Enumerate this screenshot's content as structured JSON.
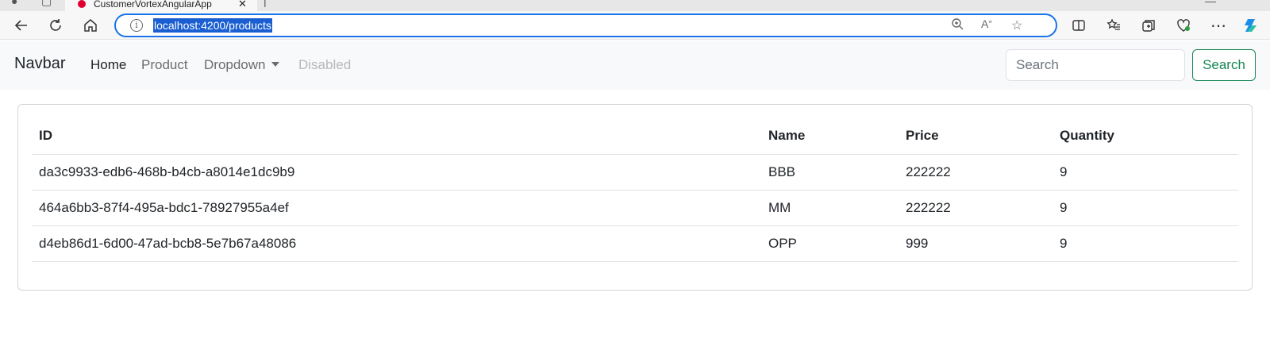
{
  "browser": {
    "tab_title": "CustomerVortexAngularApp",
    "url": "localhost:4200/products"
  },
  "navbar": {
    "brand": "Navbar",
    "links": [
      {
        "label": "Home"
      },
      {
        "label": "Product"
      },
      {
        "label": "Dropdown"
      },
      {
        "label": "Disabled"
      }
    ],
    "search_placeholder": "Search",
    "search_button": "Search"
  },
  "table": {
    "headers": [
      "ID",
      "Name",
      "Price",
      "Quantity"
    ],
    "rows": [
      [
        "da3c9933-edb6-468b-b4cb-a8014e1dc9b9",
        "BBB",
        "222222",
        "9"
      ],
      [
        "464a6bb3-87f4-495a-bdc1-78927955a4ef",
        "MM",
        "222222",
        "9"
      ],
      [
        "d4eb86d1-6d00-47ad-bcb8-5e7b67a48086",
        "OPP",
        "999",
        "9"
      ]
    ]
  },
  "colors": {
    "accent": "#1a73e8",
    "success": "#198754",
    "navbar_bg": "#f8f9fa"
  }
}
